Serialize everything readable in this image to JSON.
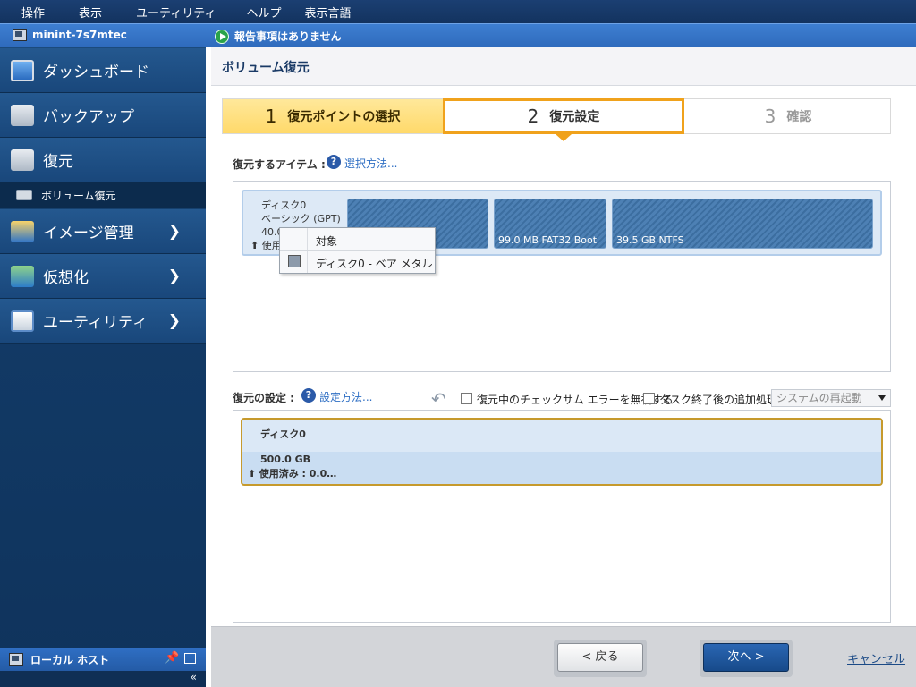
{
  "menu": [
    "操作",
    "表示",
    "ユーティリティ",
    "ヘルプ",
    "表示言語"
  ],
  "statusbar": {
    "host": "minint-7s7mtec",
    "status": "報告事項はありません"
  },
  "sidebar": {
    "items": [
      {
        "label": "ダッシュボード",
        "icon": "monitor-icon"
      },
      {
        "label": "バックアップ",
        "icon": "backup-icon"
      },
      {
        "label": "復元",
        "icon": "restore-icon"
      },
      {
        "label": "イメージ管理",
        "icon": "image-management-icon"
      },
      {
        "label": "仮想化",
        "icon": "virtualization-icon"
      },
      {
        "label": "ユーティリティ",
        "icon": "utility-icon"
      }
    ],
    "sub_item": "ボリューム復元",
    "footer_label": "ローカル ホスト",
    "collapse": "«"
  },
  "main": {
    "title": "ボリューム復元",
    "steps": [
      {
        "num": "1",
        "label": "復元ポイントの選択"
      },
      {
        "num": "2",
        "label": "復元設定"
      },
      {
        "num": "3",
        "label": "確認"
      }
    ],
    "items_label": "復元するアイテム :",
    "items_help": "選択方法...",
    "disk": {
      "name": "ディスク0",
      "type": "ベーシック (GPT)",
      "size_partial": "40.0",
      "used_partial": "使用"
    },
    "partitions": [
      {
        "label": ""
      },
      {
        "label": "99.0 MB FAT32 Boot"
      },
      {
        "label": "39.5 GB NTFS"
      }
    ],
    "context_menu": {
      "header": "対象",
      "item": "ディスク0 - ベア メタル"
    },
    "settings_label": "復元の設定 :",
    "settings_help": "設定方法...",
    "checksum_label": "復元中のチェックサム エラーを無視する",
    "post_task_label": "タスク終了後の追加処理",
    "post_task_select": "システムの再起動",
    "target": {
      "name": "ディスク0",
      "size": "500.0 GB",
      "used": "使用済み : 0.0…"
    }
  },
  "footer": {
    "back": "< 戻る",
    "next": "次へ >",
    "cancel": "キャンセル"
  },
  "colors": {
    "accent": "#f0a21c",
    "nav_bg": "#19477b",
    "link": "#2f6fc4"
  }
}
